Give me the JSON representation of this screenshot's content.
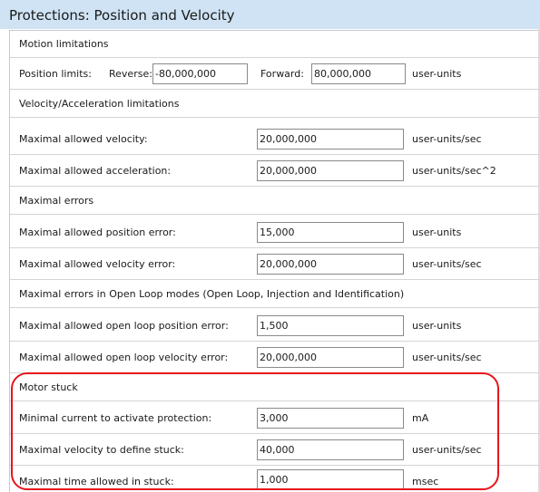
{
  "title": "Protections: Position and Velocity",
  "sections": {
    "motion": "Motion limitations",
    "velacc": "Velocity/Acceleration limitations",
    "errors": "Maximal errors",
    "openloop": "Maximal errors in Open Loop modes (Open Loop, Injection and Identification)",
    "stuck": "Motor stuck"
  },
  "position_limits": {
    "label": "Position limits:",
    "reverse_label": "Reverse:",
    "reverse_value": "-80,000,000",
    "forward_label": "Forward:",
    "forward_value": "80,000,000",
    "unit": "user-units"
  },
  "fields": {
    "max_velocity": {
      "label": "Maximal allowed velocity:",
      "value": "20,000,000",
      "unit": "user-units/sec"
    },
    "max_acceleration": {
      "label": "Maximal allowed acceleration:",
      "value": "20,000,000",
      "unit": "user-units/sec^2"
    },
    "max_pos_error": {
      "label": "Maximal allowed position error:",
      "value": "15,000",
      "unit": "user-units"
    },
    "max_vel_error": {
      "label": "Maximal allowed velocity error:",
      "value": "20,000,000",
      "unit": "user-units/sec"
    },
    "max_ol_pos_error": {
      "label": "Maximal allowed open loop position error:",
      "value": "1,500",
      "unit": "user-units"
    },
    "max_ol_vel_error": {
      "label": "Maximal allowed open loop velocity error:",
      "value": "20,000,000",
      "unit": "user-units/sec"
    },
    "min_current": {
      "label": "Minimal current to activate protection:",
      "value": "3,000",
      "unit": "mA"
    },
    "max_stuck_velocity": {
      "label": "Maximal velocity to define stuck:",
      "value": "40,000",
      "unit": "user-units/sec"
    },
    "max_stuck_time": {
      "label": "Maximal time allowed in stuck:",
      "value": "1,000",
      "unit": "msec"
    }
  },
  "colors": {
    "title_bar": "#cfe3f4",
    "highlight": "#e8141c"
  }
}
